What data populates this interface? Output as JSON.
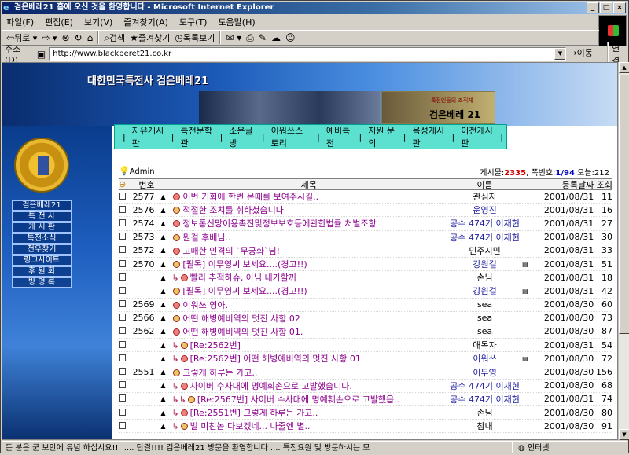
{
  "window": {
    "title": "검은베레21 홈에 오신 것을 환영합니다 - Microsoft Internet Explorer",
    "btn_min": "_",
    "btn_max": "□",
    "btn_close": "×"
  },
  "menu": [
    "파일(F)",
    "편집(E)",
    "보기(V)",
    "즐겨찾기(A)",
    "도구(T)",
    "도움말(H)"
  ],
  "toolbar": {
    "back": "뒤로",
    "search": "검색",
    "favorites": "즐겨찾기",
    "history": "목록보기"
  },
  "address": {
    "label": "주소(D)",
    "url": "http://www.blackberet21.co.kr",
    "go": "이동",
    "links": "연결"
  },
  "banner": {
    "title": "대한민국특전사 검은베레21",
    "logo_sub": "특전인들의 조직체 !",
    "logo_main": "검은베레 21"
  },
  "leftmenu": [
    "검은베레21",
    "특 전 사",
    "게 시 판",
    "특전소식",
    "전우찾기",
    "링크사이트",
    "후 원 회",
    "방 명 록"
  ],
  "nav": [
    "자유게시판",
    "특전문학관",
    "소운글방",
    "이워쓰스토리",
    "예비특전",
    "지원 문의",
    "음성게시판",
    "이전게시판"
  ],
  "board": {
    "admin": "Admin",
    "count_label": "게시물:",
    "count": "2335",
    "page_label": ", 쪽번호:",
    "page": "1/94",
    "today_label": " 오늘:",
    "today": "212",
    "headers": {
      "num": "번호",
      "subject": "제목",
      "name": "이름",
      "date": "등록날짜",
      "views": "조회"
    },
    "rows": [
      {
        "num": "2577",
        "reply": "",
        "subject": "이번 기회에 한번 몬때를 보여주시길..",
        "name": "관심자",
        "name_blue": false,
        "date": "2001/08/31",
        "views": "11",
        "att": false
      },
      {
        "num": "2576",
        "reply": "",
        "subject": "적절한 조치를 취하셨습니다",
        "name": "운영진",
        "name_blue": true,
        "date": "2001/08/31",
        "views": "16",
        "att": false
      },
      {
        "num": "2574",
        "reply": "",
        "subject": "정보통신망이용촉진및정보보호등에관한법률 처벌조항",
        "name": "공수 474기 이재현",
        "name_blue": true,
        "date": "2001/08/31",
        "views": "27",
        "att": false
      },
      {
        "num": "2573",
        "reply": "",
        "subject": "뭔걸 후배님..",
        "name": "공수 474기 이재현",
        "name_blue": true,
        "date": "2001/08/31",
        "views": "30",
        "att": false
      },
      {
        "num": "2572",
        "reply": "",
        "subject": "고매한 인격의 `무궁화`님!",
        "name": "민주시민",
        "name_blue": false,
        "date": "2001/08/31",
        "views": "33",
        "att": false
      },
      {
        "num": "2570",
        "reply": "",
        "subject": "[필독] 이무영씨 보세요....(경고!!)",
        "name": "강원걸",
        "name_blue": true,
        "date": "2001/08/31",
        "views": "51",
        "att": true
      },
      {
        "num": "",
        "reply": "↳",
        "subject": "빨리 추적하슈, 아님 내가할꺼",
        "name": "손님",
        "name_blue": false,
        "date": "2001/08/31",
        "views": "18",
        "att": false
      },
      {
        "num": "",
        "reply": "",
        "subject": "[필독] 이무영씨 보세요....(경고!!)",
        "name": "강원걸",
        "name_blue": true,
        "date": "2001/08/31",
        "views": "42",
        "att": true
      },
      {
        "num": "2569",
        "reply": "",
        "subject": "이워쓰 영아.",
        "name": "sea",
        "name_blue": false,
        "date": "2001/08/30",
        "views": "60",
        "att": false
      },
      {
        "num": "2566",
        "reply": "",
        "subject": "어떤 해병예비역의 멋진 사항 02",
        "name": "sea",
        "name_blue": false,
        "date": "2001/08/30",
        "views": "73",
        "att": false
      },
      {
        "num": "2562",
        "reply": "",
        "subject": "어떤 해병예비역의 멋진 사항 01.",
        "name": "sea",
        "name_blue": false,
        "date": "2001/08/30",
        "views": "87",
        "att": false
      },
      {
        "num": "",
        "reply": "↳",
        "subject": "[Re:2562번]",
        "name": "애독자",
        "name_blue": false,
        "date": "2001/08/31",
        "views": "54",
        "att": false
      },
      {
        "num": "",
        "reply": "↳",
        "subject": "[Re:2562번] 어떤 해병예비역의 멋진 사항 01.",
        "name": "이워쓰",
        "name_blue": true,
        "date": "2001/08/30",
        "views": "72",
        "att": true
      },
      {
        "num": "2551",
        "reply": "",
        "subject": "그렇게 하루는 가고..",
        "name": "이무영",
        "name_blue": true,
        "date": "2001/08/30",
        "views": "156",
        "att": false
      },
      {
        "num": "",
        "reply": "↳",
        "subject": "사이버 수사대에 명예회손으로 고발했습니다.",
        "name": "공수 474기 이재현",
        "name_blue": true,
        "date": "2001/08/30",
        "views": "68",
        "att": false
      },
      {
        "num": "",
        "reply": "↳↳",
        "subject": "[Re:2567번] 사이버 수사대에 명예훼손으로 고발했읍..",
        "name": "공수 474기 이재현",
        "name_blue": true,
        "date": "2001/08/31",
        "views": "74",
        "att": false
      },
      {
        "num": "",
        "reply": "↳",
        "subject": "[Re:2551번] 그렇게 하루는 가고..",
        "name": "손님",
        "name_blue": false,
        "date": "2001/08/30",
        "views": "80",
        "att": false
      },
      {
        "num": "",
        "reply": "↳",
        "subject": "벌 미친놈 다보겠네... 나줄엔 별..",
        "name": "참내",
        "name_blue": false,
        "date": "2001/08/30",
        "views": "91",
        "att": false
      }
    ]
  },
  "status": {
    "message": "든 분은 군 보안에 유념 하십시요!!! ....  단결!!!! 검은베레21 방문을 환영합니다 ....  특전요원 및 방문하시는 모",
    "zone": "인터넷"
  }
}
